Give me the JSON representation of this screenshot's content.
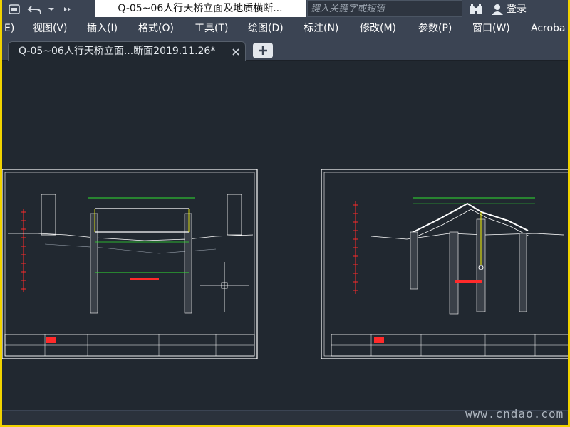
{
  "title_bar": {
    "document_title": "Q-05~06人行天桥立面及地质横断...",
    "search_placeholder": "键入关键字或短语",
    "login_label": "登录",
    "icons": [
      "app-icon",
      "undo-icon",
      "dropdown-arrow-icon",
      "more-icon",
      "chevron-right-icon",
      "binoculars-icon",
      "user-icon"
    ]
  },
  "menu": {
    "items": [
      "E)",
      "视图(V)",
      "插入(I)",
      "格式(O)",
      "工具(T)",
      "绘图(D)",
      "标注(N)",
      "修改(M)",
      "参数(P)",
      "窗口(W)",
      "Acroba"
    ]
  },
  "tabs": {
    "active_label": "Q-05~06人行天桥立面...断面2019.11.26*",
    "new_tab_icon": "plus-icon",
    "close_icon": "close-icon"
  },
  "watermark": "www.cndao.com",
  "colors": {
    "frame": "#f1d300",
    "chrome": "#3b4453",
    "canvas": "#212830",
    "cad_green": "#2fe02f",
    "cad_red": "#ff2a2a",
    "cad_yellow": "#f5f500",
    "cad_white": "#ffffff"
  }
}
